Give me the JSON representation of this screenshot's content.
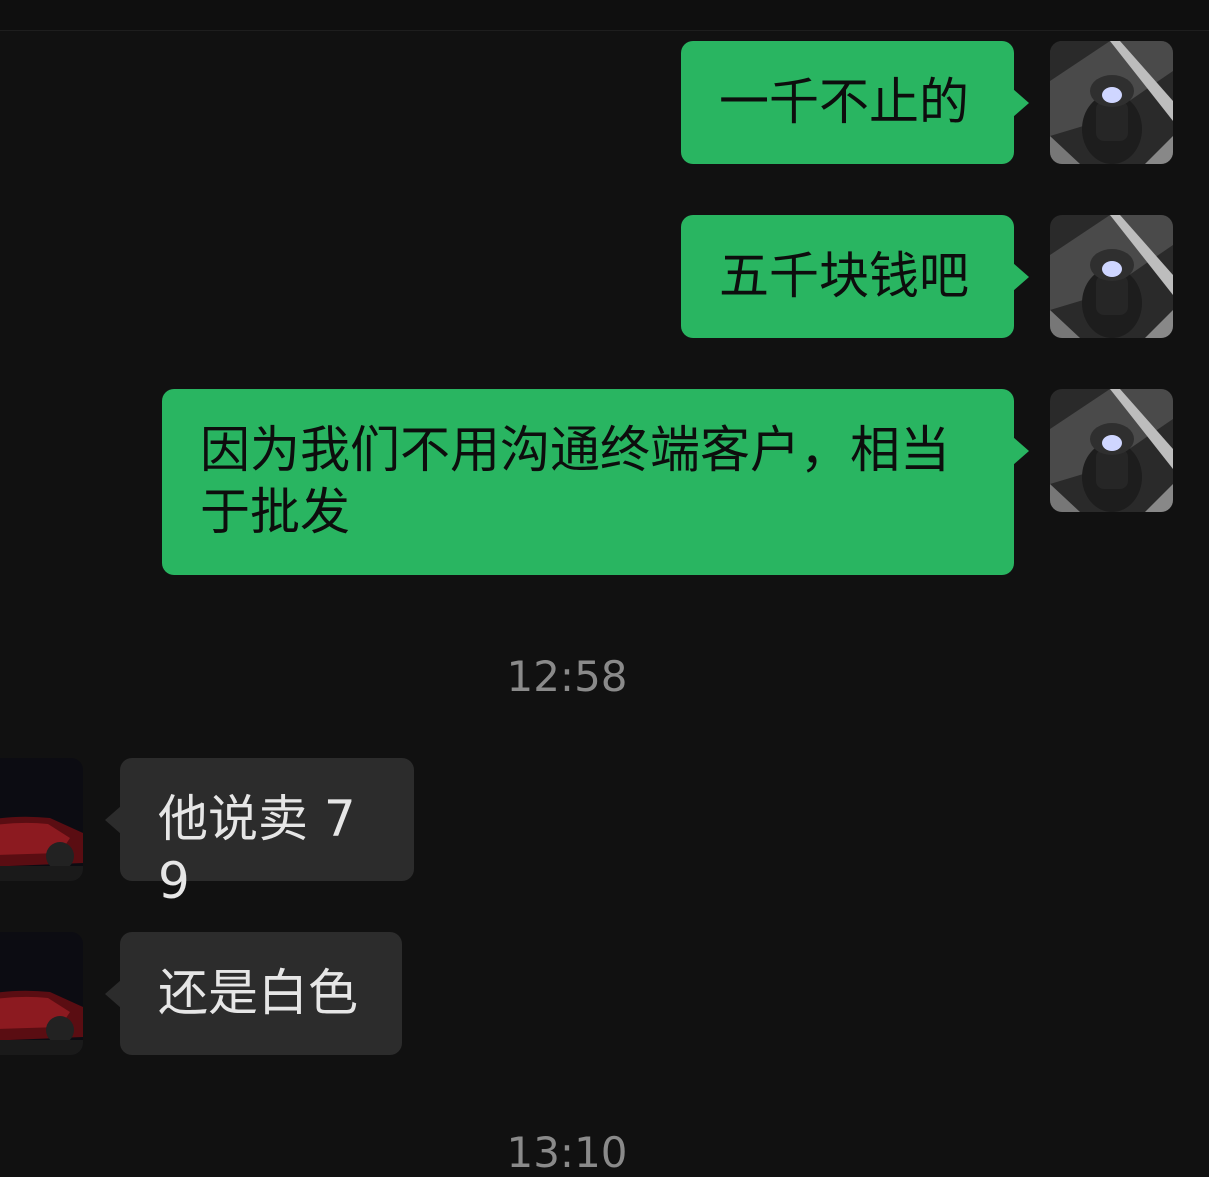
{
  "messages": [
    {
      "side": "out",
      "text": "一千不止的"
    },
    {
      "side": "out",
      "text": "五千块钱吧"
    },
    {
      "side": "out",
      "text": "因为我们不用沟通终端客户，相当于批发"
    },
    {
      "timestamp": "12:58"
    },
    {
      "side": "in",
      "text": "他说卖 79"
    },
    {
      "side": "in",
      "text": "还是白色"
    },
    {
      "timestamp": "13:10"
    }
  ],
  "avatars": {
    "self": "gear-shifter-avatar",
    "contact": "red-car-avatar"
  },
  "colors": {
    "background": "#111111",
    "outgoing_bubble": "#29b561",
    "incoming_bubble": "#2c2c2c",
    "timestamp_text": "#8a8a8a"
  }
}
